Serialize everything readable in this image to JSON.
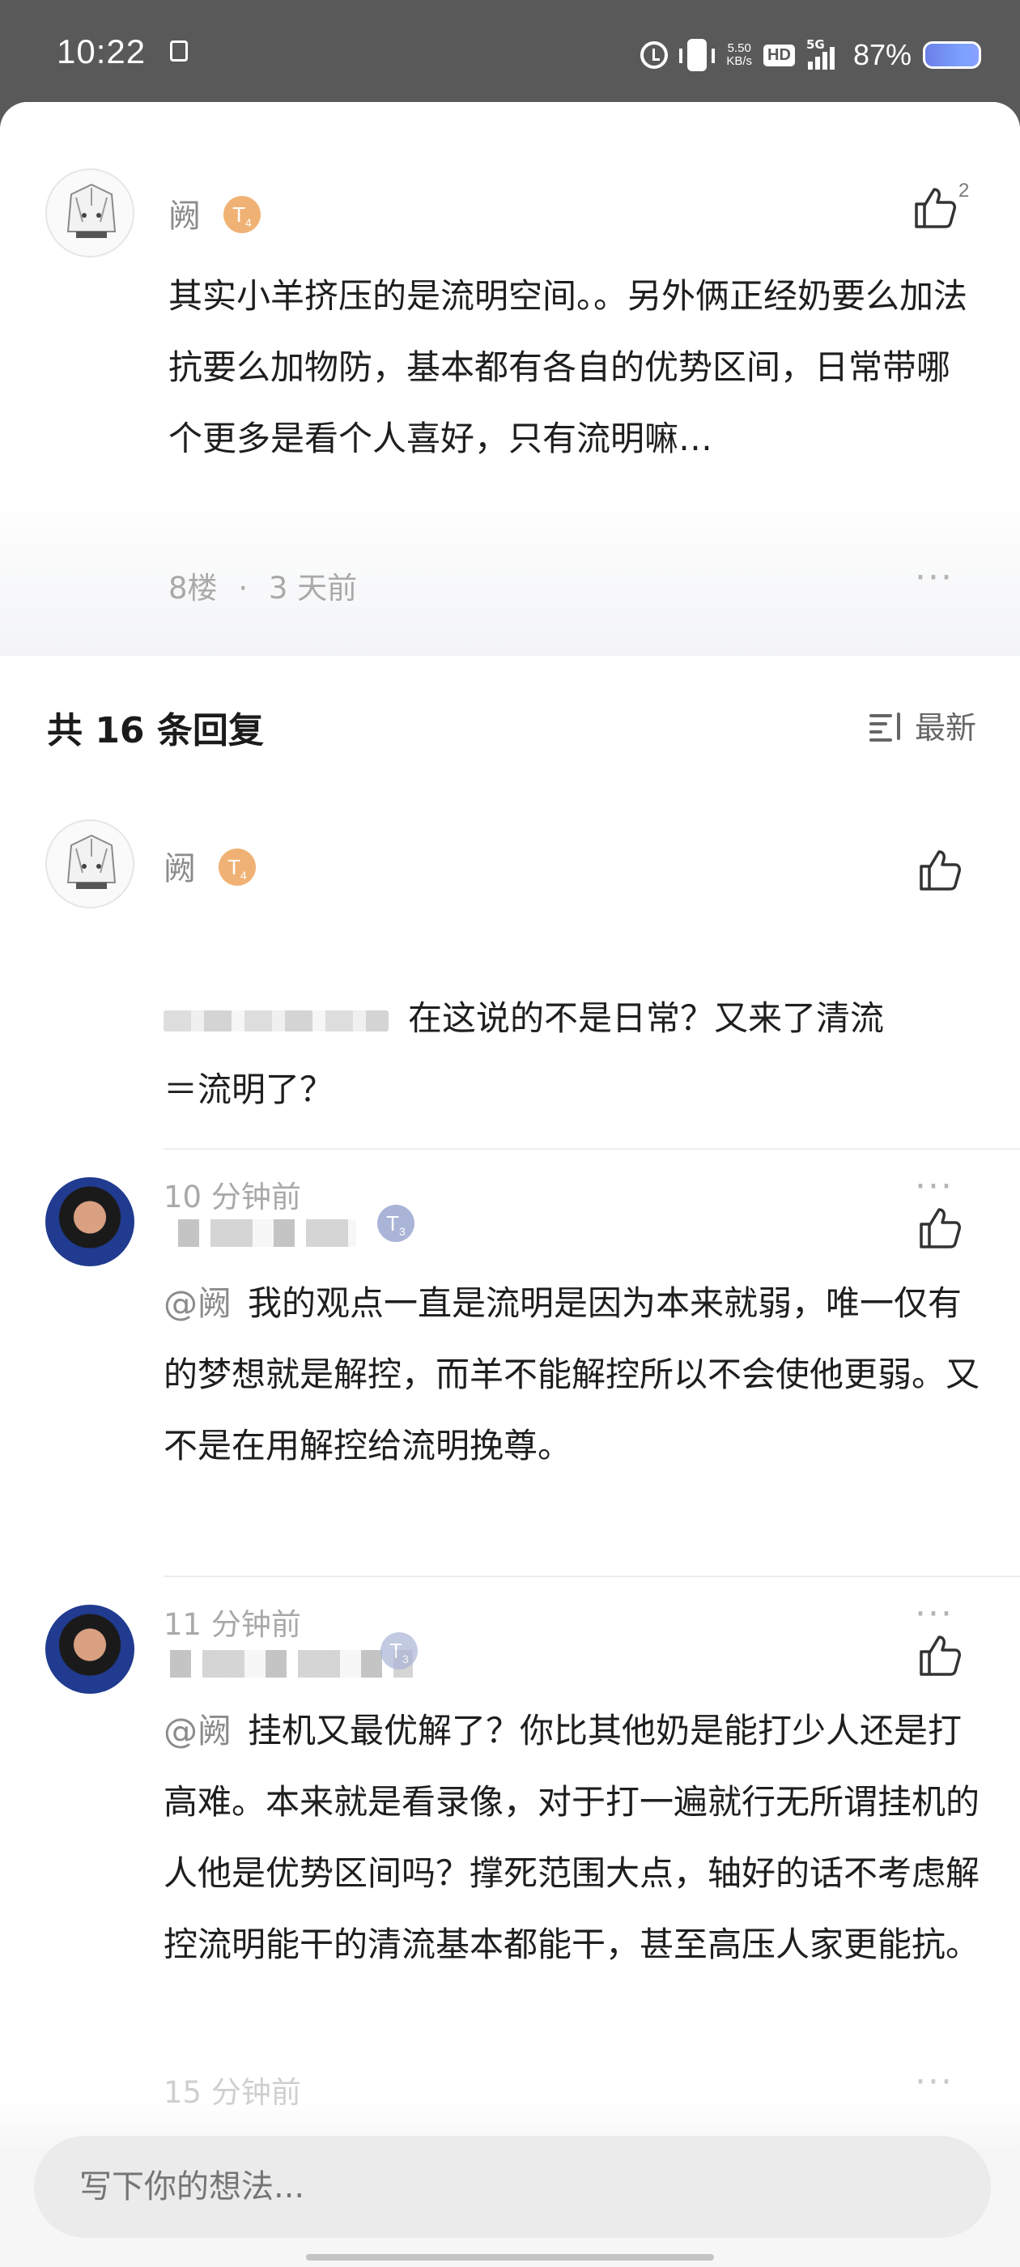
{
  "status_bar": {
    "time": "10:22",
    "net_speed_value": "5.50",
    "net_speed_unit": "KB/s",
    "hd_label": "HD",
    "network_label": "5G",
    "battery_percent": "87%",
    "icons": [
      "document-icon",
      "alarm-icon",
      "vibrate-icon",
      "signal-icon",
      "battery-icon"
    ]
  },
  "main_comment": {
    "username": "阙",
    "level": "T",
    "level_sub": "4",
    "like_count": "2",
    "text": "其实小羊挤压的是流明空间。。另外俩正经奶要么加法抗要么加物防，基本都有各自的优势区间，日常带哪个更多是看个人喜好，只有流明嘛…",
    "floor": "8楼",
    "separator": "·",
    "time": "3 天前",
    "more_label": "···"
  },
  "replies_header": {
    "title": "共 16 条回复",
    "sort_label": "最新"
  },
  "replies": [
    {
      "username": "阙",
      "level": "T",
      "level_sub": "4",
      "text_line1": "在这说的不是日常？又来了清流",
      "text_line2": "＝流明了？",
      "time": "10 分钟前",
      "more_label": "···"
    },
    {
      "level": "T",
      "level_sub": "3",
      "mention": "@阙",
      "text": "我的观点一直是流明是因为本来就弱，唯一仅有的梦想就是解控，而羊不能解控所以不会使他更弱。又不是在用解控给流明挽尊。",
      "time": "11 分钟前",
      "more_label": "···"
    },
    {
      "level": "T",
      "level_sub": "3",
      "mention": "@阙",
      "text": "挂机又最优解了？你比其他奶是能打少人还是打高难。本来就是看录像，对于打一遍就行无所谓挂机的人他是优势区间吗？撑死范围大点，轴好的话不考虑解控流明能干的清流基本都能干，甚至高压人家更能抗。",
      "time": "15 分钟前",
      "more_label": "···"
    }
  ],
  "input": {
    "placeholder": "写下你的想法..."
  }
}
